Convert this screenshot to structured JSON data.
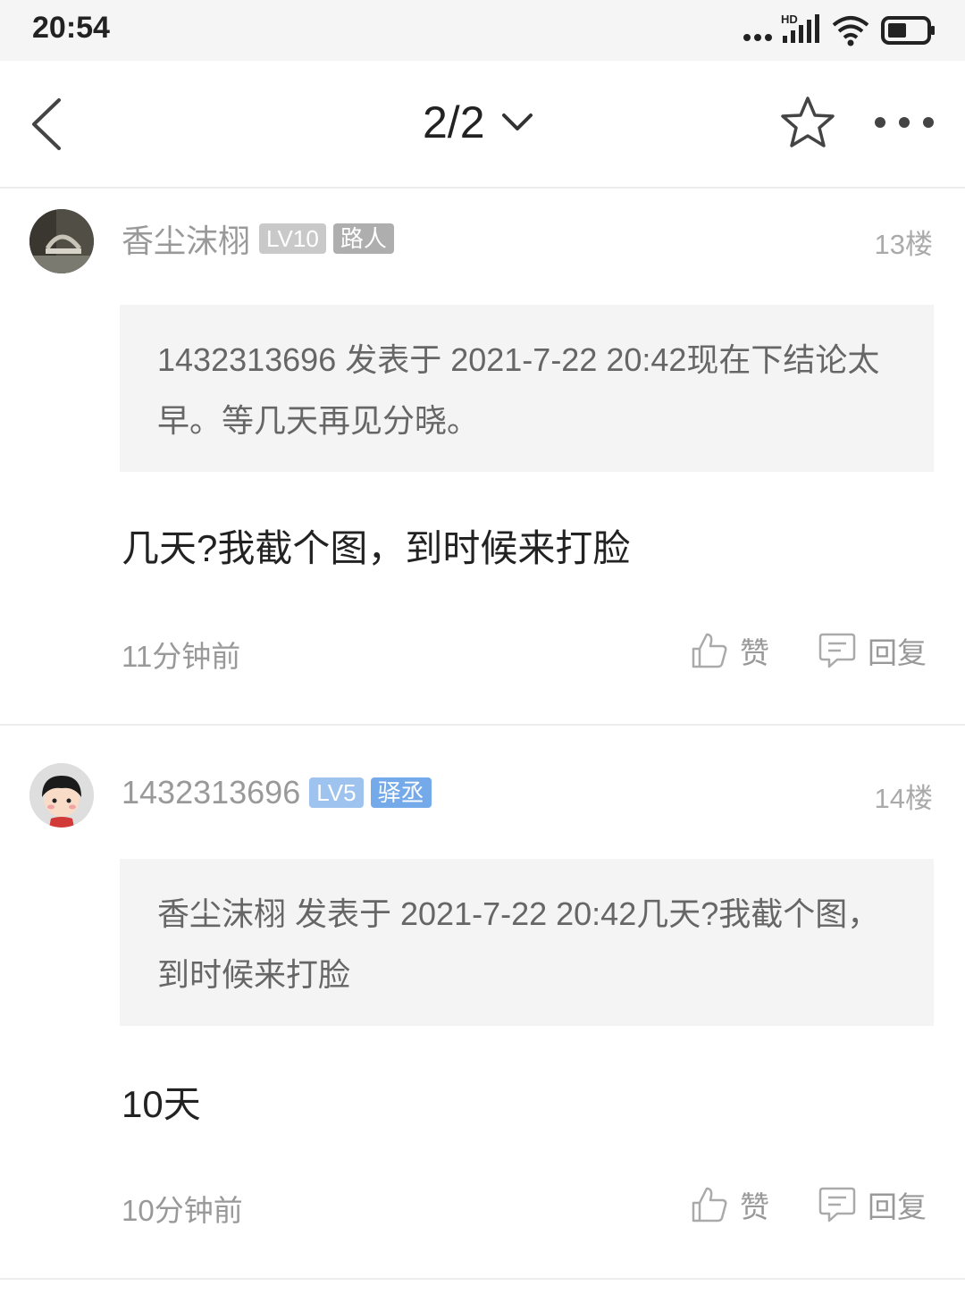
{
  "status_bar": {
    "time": "20:54",
    "network": "HD"
  },
  "nav": {
    "page_indicator": "2/2"
  },
  "posts": [
    {
      "username": "香尘沫栩",
      "level": "LV10",
      "title": "路人",
      "floor": "13楼",
      "quote": "1432313696 发表于 2021-7-22 20:42现在下结论太早。等几天再见分晓。",
      "content": "几天?我截个图，到时候来打脸",
      "time_ago": "11分钟前",
      "like_label": "赞",
      "reply_label": "回复"
    },
    {
      "username": "1432313696",
      "level": "LV5",
      "title": "驿丞",
      "floor": "14楼",
      "quote": "香尘沫栩 发表于 2021-7-22 20:42几天?我截个图，到时候来打脸",
      "content": "10天",
      "time_ago": "10分钟前",
      "like_label": "赞",
      "reply_label": "回复"
    }
  ]
}
